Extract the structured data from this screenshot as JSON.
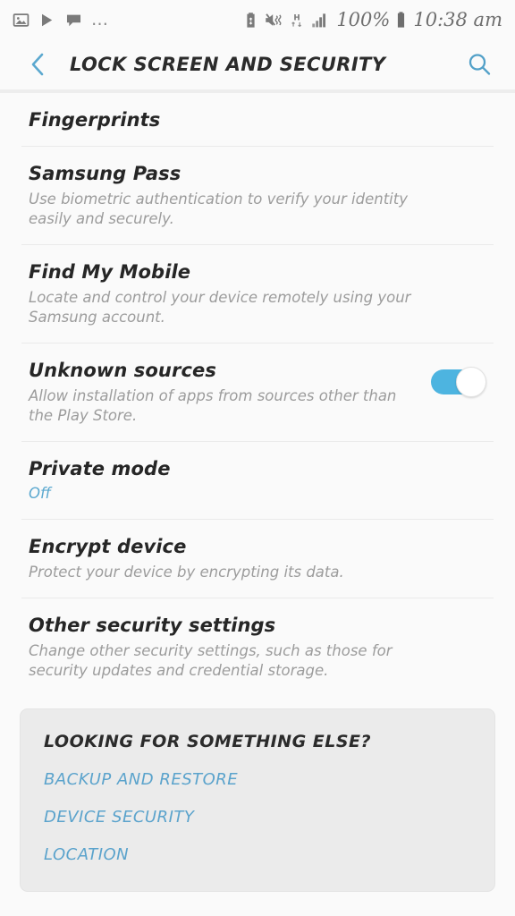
{
  "status_bar": {
    "left_icons": [
      "image-icon",
      "play-store-icon",
      "chat-bubble-icon",
      "overflow-dots-icon"
    ],
    "overflow_dots": "…",
    "right_icons": [
      "battery-saver-icon",
      "sound-mute-vibrate-icon",
      "hspa-data-icon",
      "signal-bars-icon",
      "battery-full-icon"
    ],
    "data_network_label": "H",
    "battery_percent": "100%",
    "time": "10:38 am"
  },
  "header": {
    "back_icon": "chevron-left-icon",
    "title": "LOCK SCREEN AND SECURITY",
    "search_icon": "search-icon"
  },
  "settings": [
    {
      "name": "fingerprints",
      "title": "Fingerprints",
      "desc": "",
      "status": "",
      "toggle": null
    },
    {
      "name": "samsung-pass",
      "title": "Samsung Pass",
      "desc": "Use biometric authentication to verify your identity easily and securely.",
      "status": "",
      "toggle": null
    },
    {
      "name": "find-my-mobile",
      "title": "Find My Mobile",
      "desc": "Locate and control your device remotely using your Samsung account.",
      "status": "",
      "toggle": null
    },
    {
      "name": "unknown-sources",
      "title": "Unknown sources",
      "desc": "Allow installation of apps from sources other than the Play Store.",
      "status": "",
      "toggle": "on"
    },
    {
      "name": "private-mode",
      "title": "Private mode",
      "desc": "",
      "status": "Off",
      "toggle": null
    },
    {
      "name": "encrypt-device",
      "title": "Encrypt device",
      "desc": "Protect your device by encrypting its data.",
      "status": "",
      "toggle": null
    },
    {
      "name": "other-security-settings",
      "title": "Other security settings",
      "desc": "Change other security settings, such as those for security updates and credential storage.",
      "status": "",
      "toggle": null
    }
  ],
  "looking_card": {
    "heading": "LOOKING FOR SOMETHING ELSE?",
    "links": [
      {
        "name": "backup-and-restore",
        "label": "BACKUP AND RESTORE"
      },
      {
        "name": "device-security",
        "label": "DEVICE SECURITY"
      },
      {
        "name": "location",
        "label": "LOCATION"
      }
    ]
  },
  "colors": {
    "accent_blue": "#5BA8CF",
    "toggle_on": "#4DB4E0",
    "page_bg": "#FAFAFA",
    "card_bg": "#EBEBEB",
    "title_text": "#262626",
    "desc_text": "#9C9C9C"
  }
}
